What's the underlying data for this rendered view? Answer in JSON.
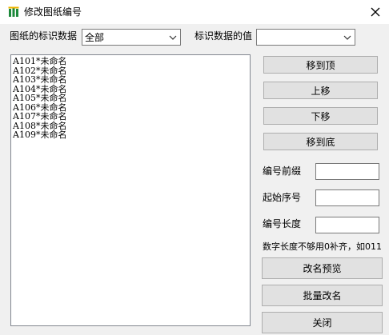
{
  "window": {
    "title": "修改图纸编号"
  },
  "filter": {
    "label": "图纸的标识数据",
    "selected": "全部",
    "value_label": "标识数据的值",
    "value_selected": ""
  },
  "list": {
    "items": [
      "A101*未命名",
      "A102*未命名",
      "A103*未命名",
      "A104*未命名",
      "A105*未命名",
      "A106*未命名",
      "A107*未命名",
      "A108*未命名",
      "A109*未命名"
    ]
  },
  "buttons": {
    "move_top": "移到顶",
    "move_up": "上移",
    "move_down": "下移",
    "move_bottom": "移到底",
    "preview": "改名预览",
    "batch_rename": "批量改名",
    "close": "关闭"
  },
  "fields": {
    "prefix_label": "编号前缀",
    "prefix_value": "",
    "start_label": "起始序号",
    "start_value": "",
    "length_label": "编号长度",
    "length_value": "",
    "hint": "数字长度不够用0补齐，如011"
  },
  "icons": {
    "app": "drawing-files-icon",
    "close": "close-icon",
    "dropdown": "chevron-down-icon"
  },
  "colors": {
    "titlebar": "#ffffff",
    "window_bg": "#f0f0f0",
    "button": "#e1e1e1",
    "app_icon": "#1e8a3c"
  }
}
